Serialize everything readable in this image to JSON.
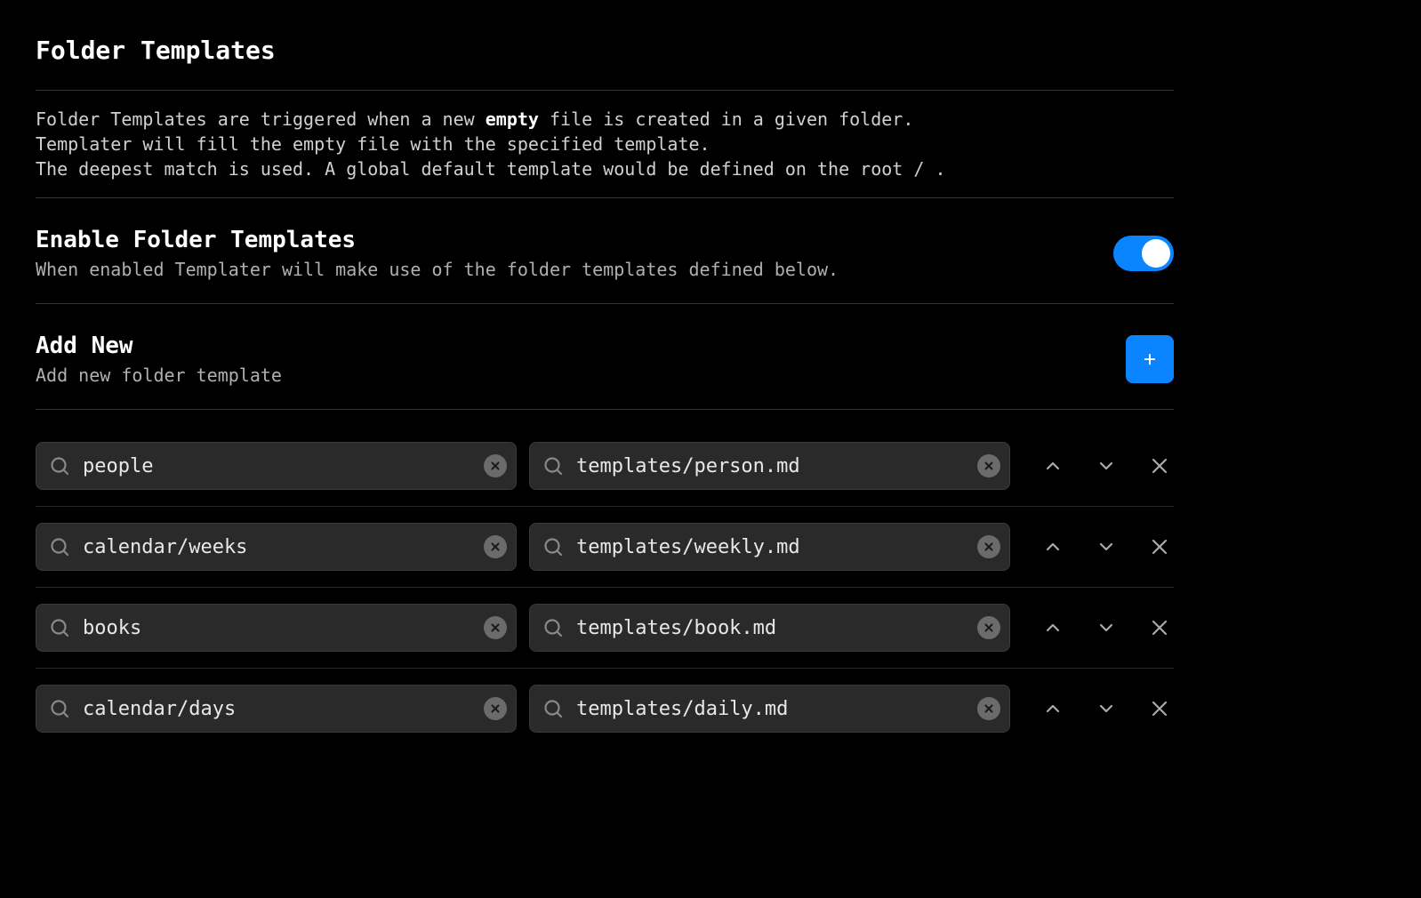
{
  "title": "Folder Templates",
  "description": {
    "line1_pre": "Folder Templates are triggered when a new ",
    "line1_bold": "empty",
    "line1_post": " file is created in a given folder.",
    "line2": "Templater will fill the empty file with the specified template.",
    "line3": "The deepest match is used. A global default template would be defined on the root / ."
  },
  "enable": {
    "title": "Enable Folder Templates",
    "subtitle": "When enabled Templater will make use of the folder templates defined below.",
    "value": true
  },
  "addnew": {
    "title": "Add New",
    "subtitle": "Add new folder template"
  },
  "rows": [
    {
      "folder": "people",
      "template": "templates/person.md"
    },
    {
      "folder": "calendar/weeks",
      "template": "templates/weekly.md"
    },
    {
      "folder": "books",
      "template": "templates/book.md"
    },
    {
      "folder": "calendar/days",
      "template": "templates/daily.md"
    }
  ]
}
